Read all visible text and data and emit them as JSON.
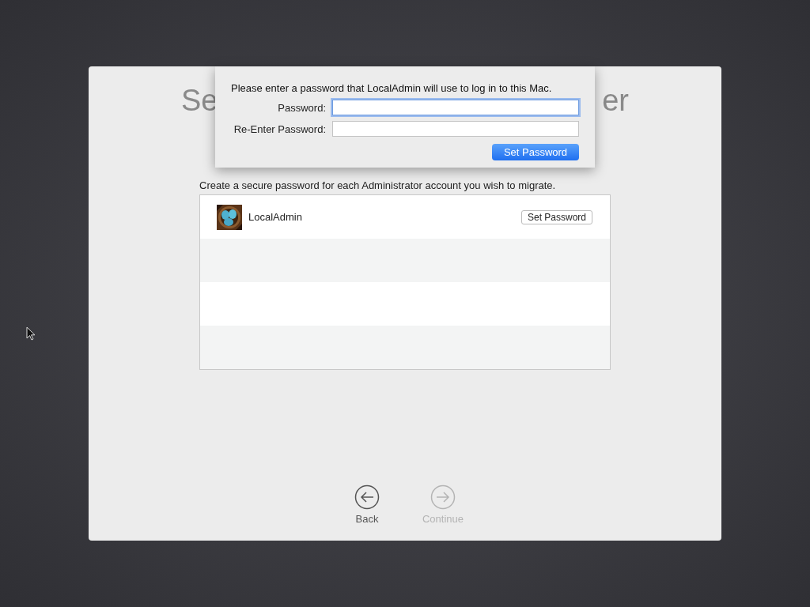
{
  "title_fragments": [
    "Se",
    "er"
  ],
  "subtitle": "Create a secure password for each Administrator account you wish to migrate.",
  "accounts": [
    {
      "name": "LocalAdmin",
      "button": "Set Password"
    }
  ],
  "sheet": {
    "message": "Please enter a password that LocalAdmin will use to log in to this Mac.",
    "fields": [
      {
        "label": "Password:",
        "focused": true
      },
      {
        "label": "Re-Enter Password:",
        "focused": false
      }
    ],
    "button": "Set Password"
  },
  "nav": [
    {
      "label": "Back",
      "kind": "back",
      "disabled": false
    },
    {
      "label": "Continue",
      "kind": "forward",
      "disabled": true
    }
  ]
}
